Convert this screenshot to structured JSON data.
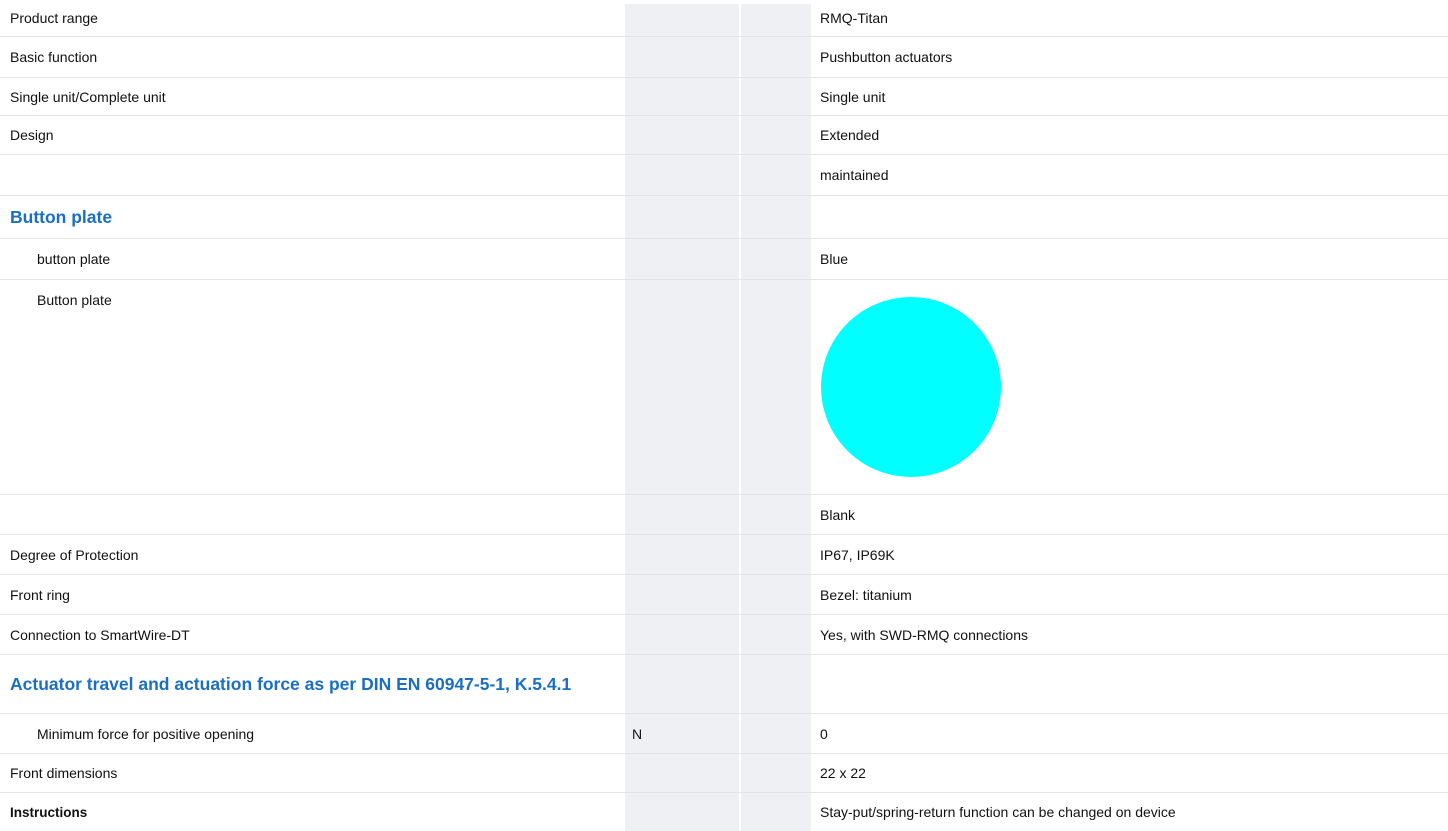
{
  "colors": {
    "heading": "#1a6fc2",
    "swatch": "#00ffff",
    "shade": "#eef0f4"
  },
  "rows": [
    {
      "label": "Product range",
      "unit": "",
      "value": "RMQ-Titan"
    },
    {
      "label": "Basic function",
      "unit": "",
      "value": "Pushbutton actuators"
    },
    {
      "label": "Single unit/Complete unit",
      "unit": "",
      "value": "Single unit"
    },
    {
      "label": "Design",
      "unit": "",
      "value": "Extended"
    },
    {
      "label": "",
      "unit": "",
      "value": "maintained"
    },
    {
      "label": "Button plate",
      "unit": "",
      "value": ""
    },
    {
      "label": "button plate",
      "unit": "",
      "value": "Blue"
    },
    {
      "label": "Button plate",
      "unit": "",
      "value_swatch": "cyan-circle"
    },
    {
      "label": "",
      "unit": "",
      "value": "Blank"
    },
    {
      "label": "Degree of Protection",
      "unit": "",
      "value": "IP67, IP69K"
    },
    {
      "label": "Front ring",
      "unit": "",
      "value": "Bezel: titanium"
    },
    {
      "label": "Connection to SmartWire-DT",
      "unit": "",
      "value": "Yes, with SWD-RMQ connections"
    },
    {
      "label": "Actuator travel and actuation force as per DIN EN 60947-5-1, K.5.4.1",
      "unit": "",
      "value": ""
    },
    {
      "label": "Minimum force for positive opening",
      "unit": "N",
      "value": "0"
    },
    {
      "label": "Front dimensions",
      "unit": "",
      "value": "22 x 22"
    },
    {
      "label": "Instructions",
      "unit": "",
      "value": "Stay-put/spring-return function can be changed on device"
    }
  ]
}
